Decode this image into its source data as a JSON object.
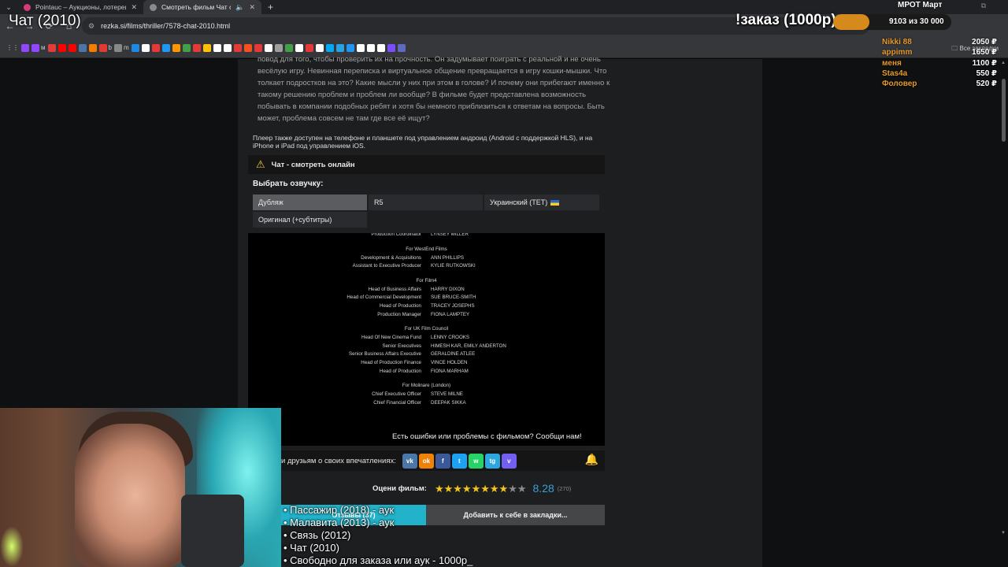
{
  "browser": {
    "tabs": [
      {
        "title": "Pointauc – Аукционы, лотереи",
        "color": "#d93a7a"
      },
      {
        "title": "Смотреть фильм Чат онлайн",
        "color": "#8a8a8a"
      }
    ],
    "url": "rezka.si/films/thriller/7578-chat-2010.html",
    "bookmarks_folder": "Все закладки",
    "bookmarks": [
      {
        "label": "",
        "color": "#9146ff"
      },
      {
        "label": "м",
        "color": "#9146ff"
      },
      {
        "label": "",
        "color": "#e23b3b"
      },
      {
        "label": "",
        "color": "#ff0000"
      },
      {
        "label": "",
        "color": "#ff0000"
      },
      {
        "label": "",
        "color": "#4a76a8"
      },
      {
        "label": "",
        "color": "#f57c00"
      },
      {
        "label": "b",
        "color": "#e53935"
      },
      {
        "label": "m",
        "color": "#888888"
      },
      {
        "label": "",
        "color": "#1e88e5"
      },
      {
        "label": "",
        "color": "#ffffff"
      },
      {
        "label": "",
        "color": "#e53935"
      },
      {
        "label": "",
        "color": "#2196f3"
      },
      {
        "label": "",
        "color": "#ff9800"
      },
      {
        "label": "",
        "color": "#43a047"
      },
      {
        "label": "",
        "color": "#e53935"
      },
      {
        "label": "",
        "color": "#ffc107"
      },
      {
        "label": "",
        "color": "#ffffff"
      },
      {
        "label": "",
        "color": "#ffffff"
      },
      {
        "label": "",
        "color": "#e53935"
      },
      {
        "label": "",
        "color": "#f4511e"
      },
      {
        "label": "",
        "color": "#e53935"
      },
      {
        "label": "",
        "color": "#ffffff"
      },
      {
        "label": "",
        "color": "#9e9e9e"
      },
      {
        "label": "",
        "color": "#43a047"
      },
      {
        "label": "",
        "color": "#ffffff"
      },
      {
        "label": "",
        "color": "#e53935"
      },
      {
        "label": "",
        "color": "#ffffff"
      },
      {
        "label": "",
        "color": "#03a9f4"
      },
      {
        "label": "",
        "color": "#26a5e4"
      },
      {
        "label": "",
        "color": "#2196f3"
      },
      {
        "label": "",
        "color": "#ffffff"
      },
      {
        "label": "",
        "color": "#ffffff"
      },
      {
        "label": "",
        "color": "#ffffff"
      },
      {
        "label": "",
        "color": "#7c4dff"
      },
      {
        "label": "",
        "color": "#5c6bc0"
      }
    ]
  },
  "page": {
    "description": "повод для того, чтобы проверить их на прочность. Он задумывает поиграть с реальной и не очень весёлую игру. Невинная переписка и виртуальное общение превращается в игру кошки-мышки. Что толкает подростков на это? Какие мысли у них при этом в голове? И почему они прибегают именно к такому решению проблем и проблем ли вообще? В фильме будет представлена возможность побывать в компании подобных ребят и хотя бы немного приблизиться к ответам на вопросы. Быть может, проблема совсем не там где все её ищут?",
    "player_note": "Плеер также доступен на телефоне и планшете под управлением андроид (Android с поддержкой HLS), и на iPhone и iPad под управлением iOS.",
    "watch_title": "Чат - смотреть онлайн",
    "dub_label": "Выбрать озвучку:",
    "dubs": [
      "Дубляж",
      "R5",
      "Украинский (ТЕТ)",
      "Оригинал (+субтитры)"
    ],
    "credits": [
      {
        "role": "Production Coordinator",
        "name": "LYNSEY MILLER"
      },
      {
        "head": "For WestEnd Films"
      },
      {
        "role": "Development & Acquisitions",
        "name": "ANN PHILLIPS"
      },
      {
        "role": "Assistant to Executive Producer",
        "name": "KYLIE RUTKOWSKI"
      },
      {
        "head": "For Film4"
      },
      {
        "role": "Head of Business Affairs",
        "name": "HARRY DIXON"
      },
      {
        "role": "Head of Commercial Development",
        "name": "SUE BRUCE-SMITH"
      },
      {
        "role": "Head of Production",
        "name": "TRACEY JOSEPHS"
      },
      {
        "role": "Production Manager",
        "name": "FIONA LAMPTEY"
      },
      {
        "head": "For UK Film Council"
      },
      {
        "role": "Head Of New Cinema Fund",
        "name": "LENNY CROOKS"
      },
      {
        "role": "Senior Executives",
        "name": "HIMESH KAR, EMILY ANDERTON"
      },
      {
        "role": "Senior Business Affairs Executive",
        "name": "GERALDINE ATLEE"
      },
      {
        "role": "Head of Production Finance",
        "name": "VINCE HOLDEN"
      },
      {
        "role": "Head of Production",
        "name": "FIONA MARHAM"
      },
      {
        "head": "For Molinare (London)"
      },
      {
        "role": "Chief Executive Officer",
        "name": "STEVE MILNE"
      },
      {
        "role": "Chief Financial Officer",
        "name": "DEEPAK SIKKA"
      }
    ],
    "report_text": "Есть ошибки или проблемы с фильмом? Сообщи нам!",
    "share_text": "и друзьям о своих впечатлениях:",
    "social": [
      {
        "label": "vk",
        "color": "#4a76a8"
      },
      {
        "label": "ok",
        "color": "#ee8208"
      },
      {
        "label": "f",
        "color": "#3b5998"
      },
      {
        "label": "t",
        "color": "#1da1f2"
      },
      {
        "label": "w",
        "color": "#25d366"
      },
      {
        "label": "tg",
        "color": "#2ca5e0"
      },
      {
        "label": "v",
        "color": "#7360f2"
      }
    ],
    "rate_label": "Оцени фильм:",
    "stars_filled": 8,
    "stars_total": 10,
    "rating": "8.28",
    "votes": "(270)",
    "reviews_button": "Отзывы (37)",
    "bookmark_button": "Добавить к себе в закладки..."
  },
  "overlay": {
    "stream_title": "Чат (2010)",
    "order_text": "!заказ (1000р)",
    "progress_text": "9103  из 30 000",
    "progress_fraction": 0.3034,
    "donors_title": "МРОТ Март",
    "donors": [
      {
        "name": "Nikki 88",
        "amount": "2050 ₽"
      },
      {
        "name": "appimm",
        "amount": "1650 ₽"
      },
      {
        "name": "меня",
        "amount": "1100 ₽"
      },
      {
        "name": "Stas4a",
        "amount": "550 ₽"
      },
      {
        "name": "Фоловер",
        "amount": "520 ₽"
      }
    ],
    "auction_list": [
      "• Пассажир (2018) - аук",
      "• Малавита (2013) - аук",
      "• Связь (2012)",
      "• Чат (2010)",
      "• Свободно для заказа или аук - 1000р"
    ],
    "cursor": "_"
  }
}
